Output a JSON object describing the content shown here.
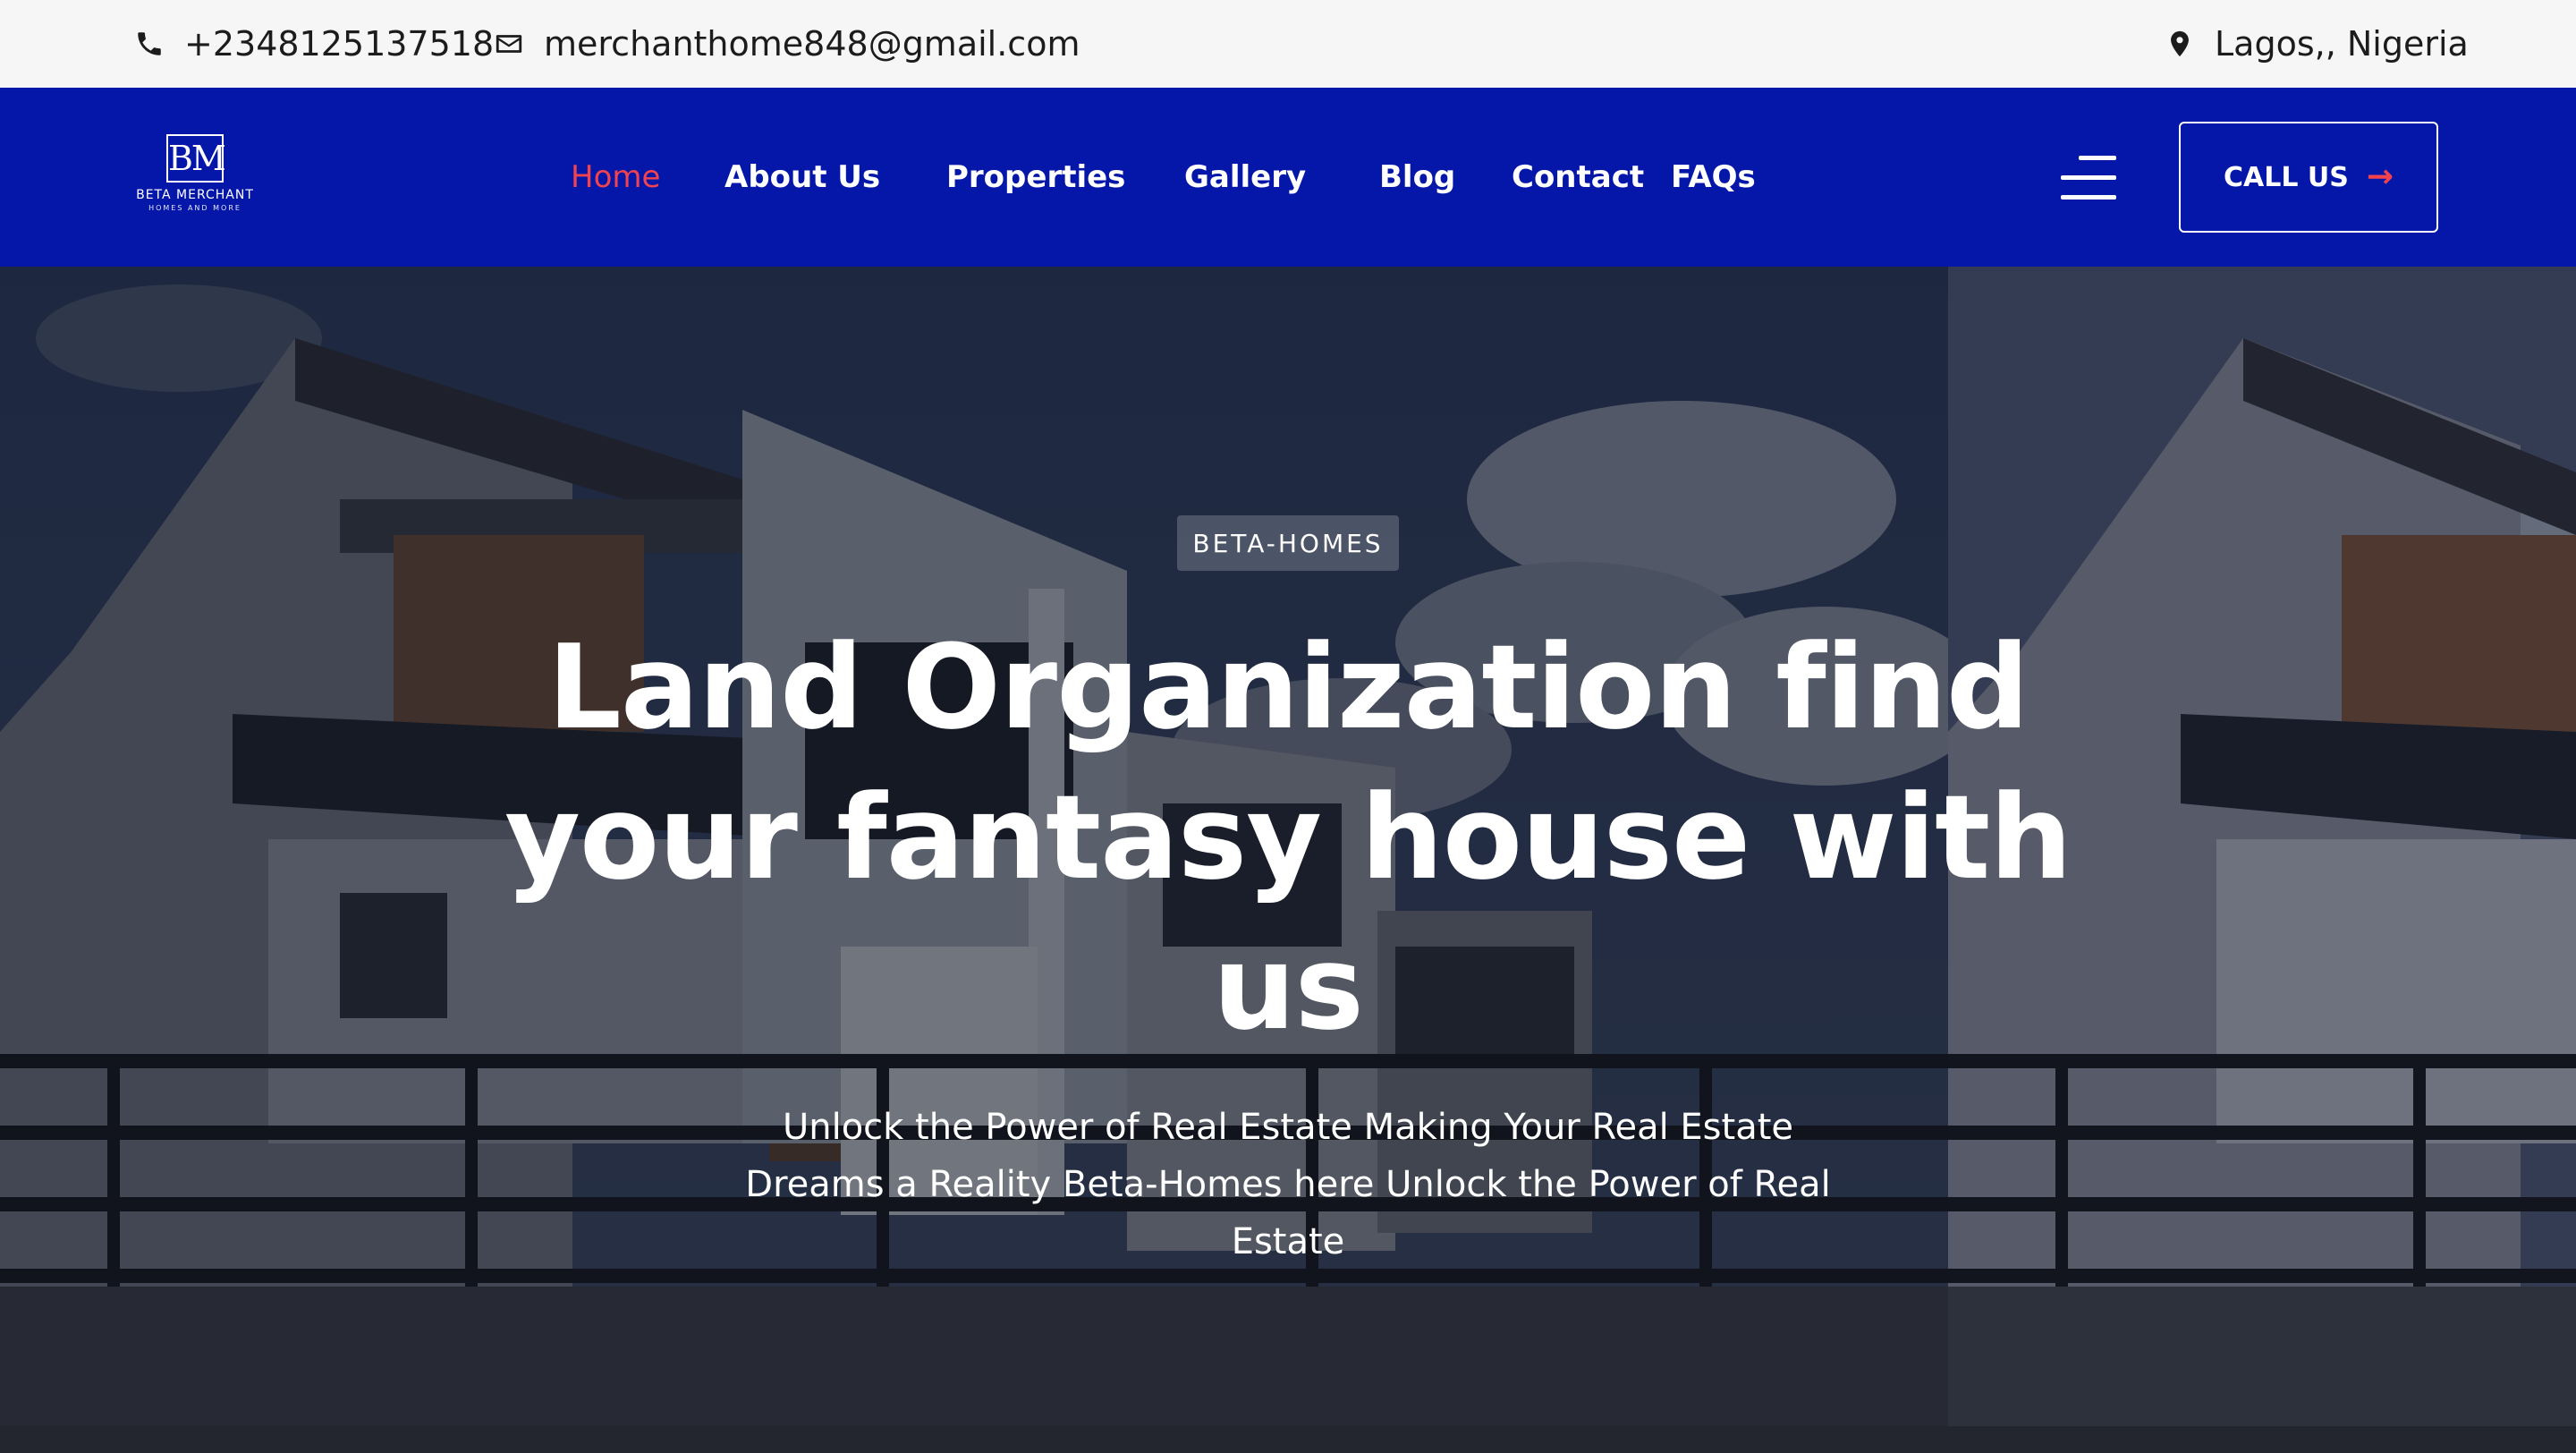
{
  "topbar": {
    "phone": "+2348125137518",
    "email": "merchanthome848@gmail.com",
    "location": "Lagos,, Nigeria",
    "icons": [
      "phone-icon",
      "envelope-icon",
      "map-pin-icon"
    ]
  },
  "header": {
    "logo": {
      "monogram": "BM",
      "brand": "BETA MERCHANT",
      "tagline": "HOMES AND MORE"
    },
    "nav": [
      {
        "label": "Home",
        "active": true
      },
      {
        "label": "About Us",
        "active": false
      },
      {
        "label": "Properties",
        "active": false
      },
      {
        "label": "Gallery",
        "active": false
      },
      {
        "label": "Blog",
        "active": false
      },
      {
        "label": "Contact",
        "active": false
      },
      {
        "label": "FAQs",
        "active": false
      }
    ],
    "menu_icon": "hamburger-icon",
    "call_label": "CALL US",
    "call_icon": "arrow-right-icon"
  },
  "hero": {
    "badge": "BETA-HOMES",
    "headline": "Land Organization find your fantasy house with us",
    "subtext": "Unlock the Power of Real Estate Making Your Real Estate Dreams a Reality Beta-Homes here Unlock the Power of Real Estate"
  },
  "colors": {
    "nav_bg": "#0517a8",
    "accent": "#f0434f",
    "topbar_bg": "#f6f6f6",
    "text_light": "#ffffff"
  }
}
